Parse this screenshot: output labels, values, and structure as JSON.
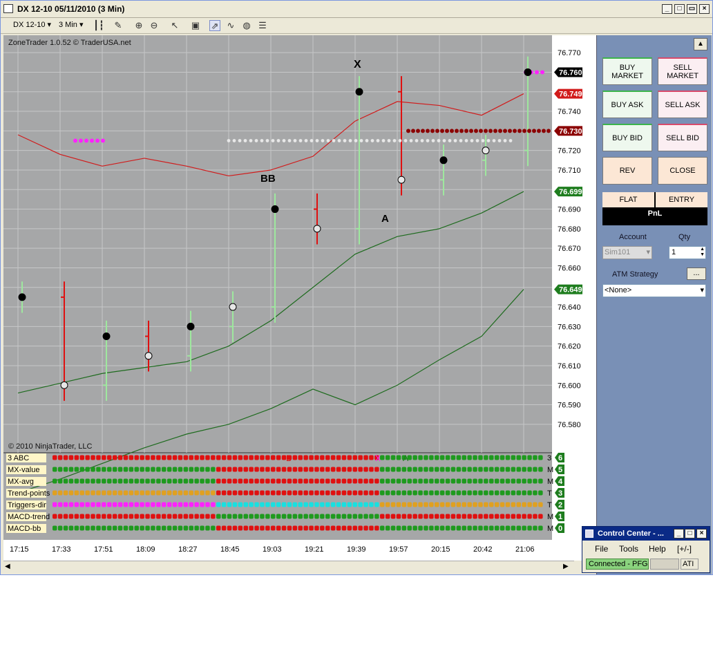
{
  "window": {
    "title": "DX 12-10  05/11/2010 (3 Min)"
  },
  "toolbar": {
    "instrument": "DX 12-10",
    "interval": "3 Min"
  },
  "chart": {
    "header_text": "ZoneTrader 1.0.52 © TraderUSA.net",
    "copyright": "© 2010 NinjaTrader, LLC",
    "annotations": {
      "x": "X",
      "bb": "BB",
      "a": "A"
    },
    "price_labels": [
      "76.770",
      "76.760",
      "76.750",
      "76.740",
      "76.730",
      "76.720",
      "76.710",
      "76.700",
      "76.690",
      "76.680",
      "76.670",
      "76.660",
      "76.650",
      "76.640",
      "76.630",
      "76.620",
      "76.610",
      "76.600",
      "76.590",
      "76.580"
    ],
    "value_badges": [
      {
        "text": "76.760",
        "color": "#000000",
        "price": 76.76
      },
      {
        "text": "76.749",
        "color": "#d11b1b",
        "price": 76.749
      },
      {
        "text": "76.730",
        "color": "#8b0000",
        "price": 76.73
      },
      {
        "text": "76.699",
        "color": "#1e7d1e",
        "price": 76.699
      },
      {
        "text": "76.649",
        "color": "#1e7d1e",
        "price": 76.649
      }
    ],
    "time_labels": [
      "17:15",
      "17:33",
      "17:51",
      "18:09",
      "18:27",
      "18:45",
      "19:03",
      "19:21",
      "19:39",
      "19:57",
      "20:15",
      "20:42",
      "21:06"
    ]
  },
  "chart_data": {
    "type": "bar",
    "title": "",
    "xlabel": "",
    "ylabel": "",
    "ylim": [
      76.575,
      76.775
    ],
    "grid": true,
    "x": [
      "17:15",
      "17:33",
      "17:51",
      "18:09",
      "18:27",
      "18:45",
      "19:03",
      "19:21",
      "19:39",
      "19:57",
      "20:15",
      "20:42",
      "21:06"
    ],
    "series": [
      {
        "name": "",
        "values": [
          76.645,
          76.6,
          76.625,
          76.615,
          76.63,
          76.64,
          76.69,
          76.68,
          76.75,
          76.705,
          76.715,
          76.72,
          76.76
        ]
      }
    ],
    "envelope_upper": [
      76.728,
      76.718,
      76.712,
      76.716,
      76.712,
      76.707,
      76.71,
      76.717,
      76.735,
      76.745,
      76.743,
      76.738,
      76.749
    ],
    "moving_average": [
      76.596,
      76.601,
      76.606,
      76.609,
      76.612,
      76.62,
      76.633,
      76.65,
      76.667,
      76.676,
      76.68,
      76.688,
      76.699
    ],
    "envelope_lower": [
      76.545,
      76.552,
      76.56,
      76.568,
      76.575,
      76.58,
      76.588,
      76.598,
      76.59,
      76.6,
      76.613,
      76.625,
      76.649
    ]
  },
  "indicators": [
    {
      "label": "3 ABC",
      "value": "6",
      "prefix": "3"
    },
    {
      "label": "MX-value",
      "value": "5",
      "prefix": "M"
    },
    {
      "label": "MX-avg",
      "value": "4",
      "prefix": "M"
    },
    {
      "label": "Trend-points",
      "value": "3",
      "prefix": "T"
    },
    {
      "label": "Triggers-dir",
      "value": "2",
      "prefix": "T"
    },
    {
      "label": "MACD-trend",
      "value": "1",
      "prefix": "M"
    },
    {
      "label": "MACD-bb",
      "value": "0",
      "prefix": "M"
    }
  ],
  "indicator_marks": {
    "b": "B",
    "x": "X",
    "a": "A"
  },
  "panel": {
    "buy_market": "BUY MARKET",
    "sell_market": "SELL MARKET",
    "buy_ask": "BUY ASK",
    "sell_ask": "SELL ASK",
    "buy_bid": "BUY BID",
    "sell_bid": "SELL BID",
    "rev": "REV",
    "close": "CLOSE",
    "flat": "FLAT",
    "entry": "ENTRY",
    "pnl": "PnL",
    "account_label": "Account",
    "qty_label": "Qty",
    "account_value": "Sim101",
    "qty_value": "1",
    "atm_label": "ATM Strategy",
    "atm_button": "...",
    "atm_value": "<None>"
  },
  "control_center": {
    "title": "Control Center - ...",
    "menu_file": "File",
    "menu_tools": "Tools",
    "menu_help": "Help",
    "menu_expand": "[+/-]",
    "status": "Connected - PFG",
    "status_right": "ATI"
  }
}
